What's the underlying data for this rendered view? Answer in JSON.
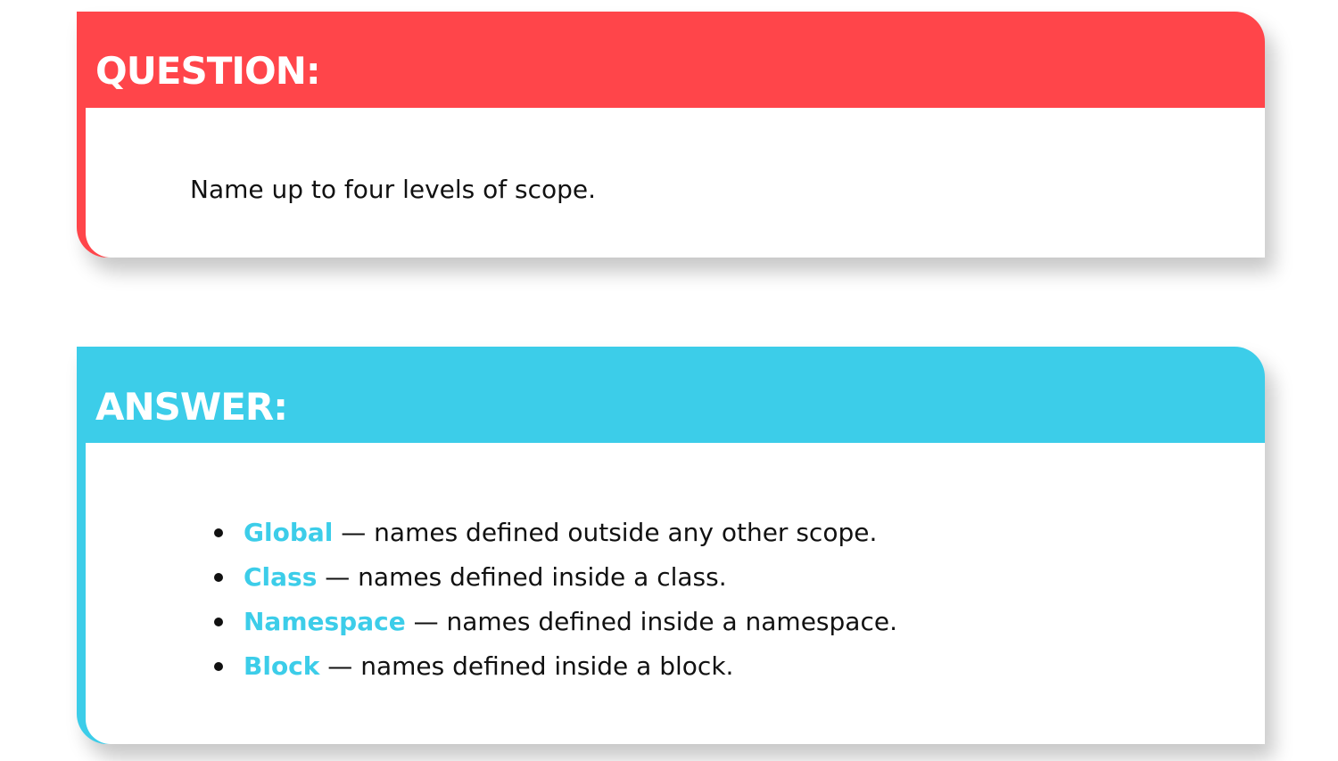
{
  "colors": {
    "question_accent": "#ff454a",
    "answer_accent": "#3ccde9",
    "text": "#111111"
  },
  "question": {
    "title": "QUESTION:",
    "text": "Name up to four levels of scope."
  },
  "answer": {
    "title": "ANSWER:",
    "items": [
      {
        "term": "Global",
        "description": " — names defined outside any other scope."
      },
      {
        "term": "Class",
        "description": " — names defined inside a class."
      },
      {
        "term": "Namespace",
        "description": " — names defined inside a namespace."
      },
      {
        "term": "Block",
        "description": " — names defined inside a block."
      }
    ]
  }
}
